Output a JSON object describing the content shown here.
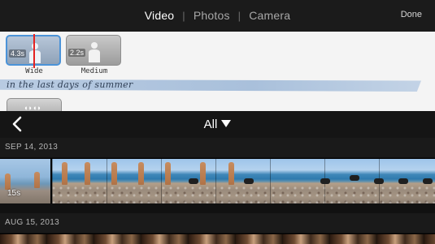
{
  "topbar": {
    "tabs": [
      "Video",
      "Photos",
      "Camera"
    ],
    "active_tab": "Video",
    "done_label": "Done"
  },
  "project": {
    "clips": [
      {
        "label": "Wide",
        "duration": "4.3s",
        "selected": true
      },
      {
        "label": "Medium",
        "duration": "2.2s",
        "selected": false
      }
    ],
    "caption": "in the last days of summer"
  },
  "browser": {
    "filter_label": "All",
    "sections": [
      {
        "date": "SEP 14, 2013",
        "clip_duration": "15s"
      },
      {
        "date": "AUG 15, 2013"
      }
    ]
  },
  "colors": {
    "accent": "#4b93d8",
    "playhead": "#e42222",
    "topbar_bg": "#1b1b1b"
  }
}
